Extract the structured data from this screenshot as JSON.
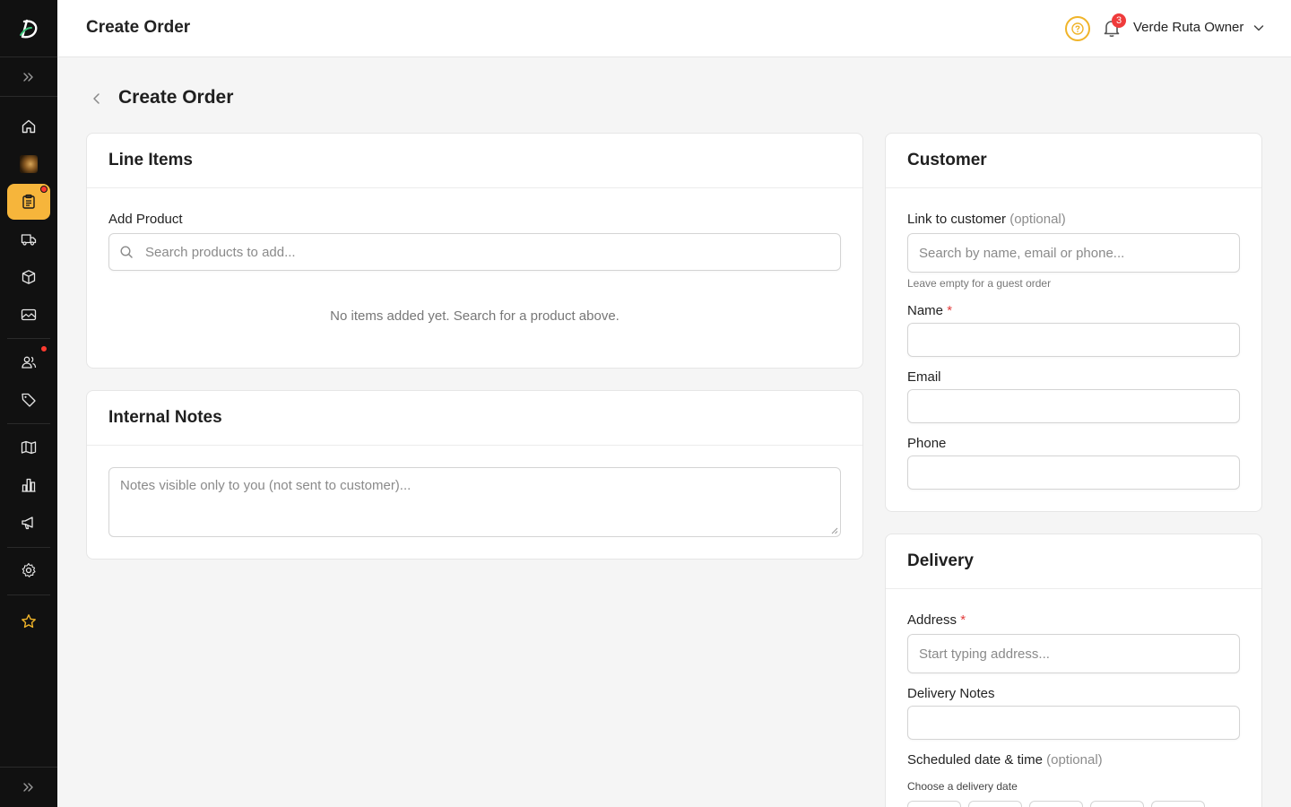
{
  "colors": {
    "accent": "#f6b53b",
    "sidebar_bg": "#111111",
    "badge": "#ef3b3b",
    "required": "#e23b3b"
  },
  "topbar": {
    "title": "Create Order",
    "notifications_count": "3",
    "user_name": "Verde Ruta Owner"
  },
  "sidebar": {
    "items": [
      {
        "icon": "home-icon"
      },
      {
        "icon": "store-avatar-icon"
      },
      {
        "icon": "clipboard-orders-icon"
      },
      {
        "icon": "truck-icon"
      },
      {
        "icon": "package-icon"
      },
      {
        "icon": "image-icon"
      },
      {
        "icon": "users-icon"
      },
      {
        "icon": "tag-icon"
      },
      {
        "icon": "map-icon"
      },
      {
        "icon": "bar-chart-icon"
      },
      {
        "icon": "megaphone-icon"
      },
      {
        "icon": "settings-icon"
      },
      {
        "icon": "star-icon"
      }
    ]
  },
  "page": {
    "title": "Create Order"
  },
  "line_items": {
    "title": "Line Items",
    "add_product_label": "Add Product",
    "search_placeholder": "Search products to add...",
    "empty_message": "No items added yet. Search for a product above."
  },
  "notes": {
    "title": "Internal Notes",
    "placeholder": "Notes visible only to you (not sent to customer)..."
  },
  "customer": {
    "title": "Customer",
    "link_label": "Link to customer",
    "optional": "(optional)",
    "search_placeholder": "Search by name, email or phone...",
    "link_hint": "Leave empty for a guest order",
    "name_label": "Name",
    "required_mark": "*",
    "email_label": "Email",
    "phone_label": "Phone"
  },
  "delivery": {
    "title": "Delivery",
    "address_label": "Address",
    "address_placeholder": "Start typing address...",
    "notes_label": "Delivery Notes",
    "scheduled_label": "Scheduled date & time",
    "optional": "(optional)",
    "date_hint": "Choose a delivery date"
  }
}
